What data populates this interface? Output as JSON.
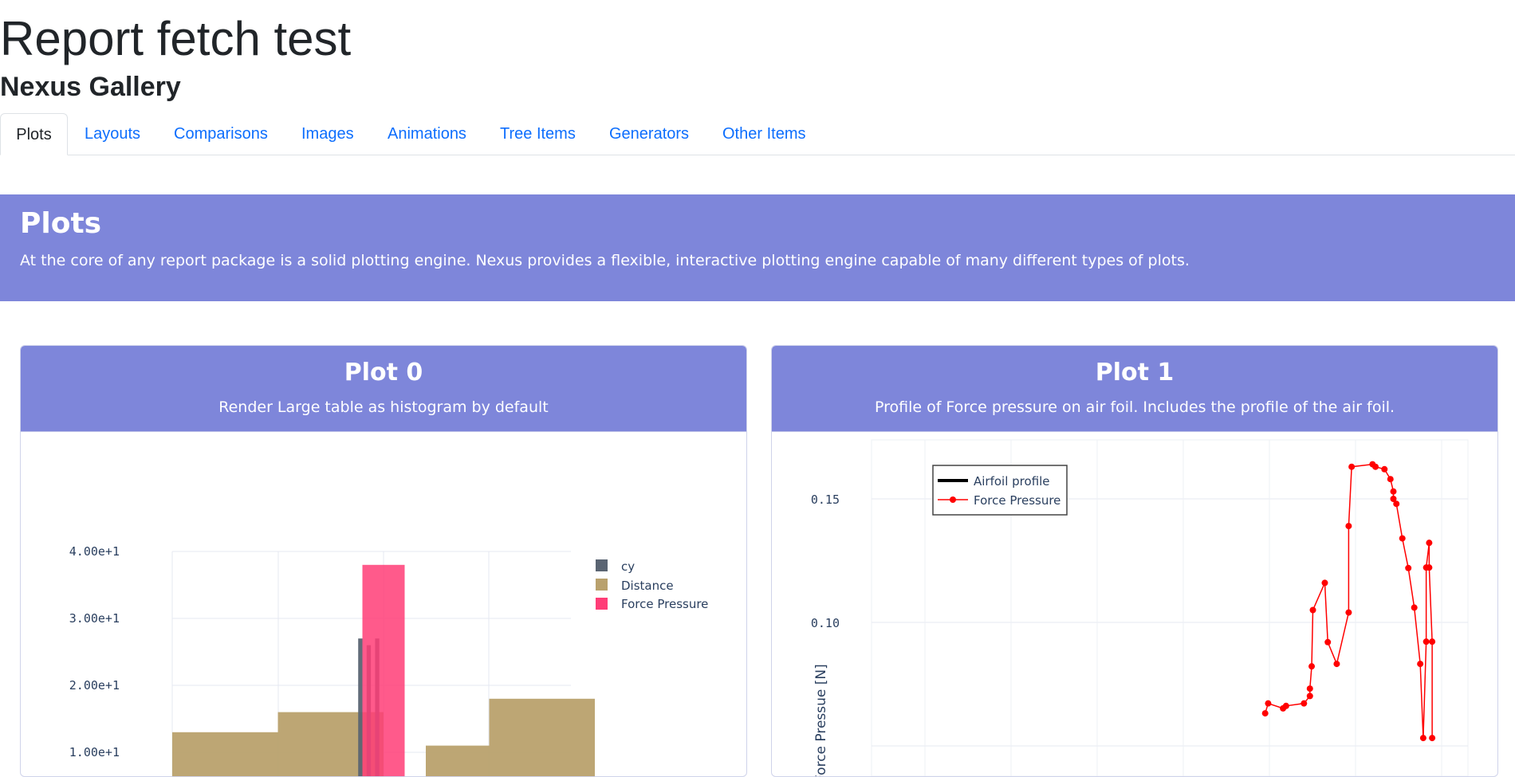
{
  "header": {
    "title": "Report fetch test",
    "gallery_title": "Nexus Gallery"
  },
  "tabs": [
    {
      "label": "Plots",
      "active": true
    },
    {
      "label": "Layouts"
    },
    {
      "label": "Comparisons"
    },
    {
      "label": "Images"
    },
    {
      "label": "Animations"
    },
    {
      "label": "Tree Items"
    },
    {
      "label": "Generators"
    },
    {
      "label": "Other Items"
    }
  ],
  "banner": {
    "title": "Plots",
    "description": "At the core of any report package is a solid plotting engine. Nexus provides a flexible, interactive plotting engine capable of many different types of plots."
  },
  "colors": {
    "banner_bg": "#7e86da",
    "link": "#0d6efd",
    "series_cy": "#5a6472",
    "series_distance": "#b9a16d",
    "series_force_pressure": "#ff3d77",
    "series_force_line": "#ff0000"
  },
  "cards": [
    {
      "title": "Plot 0",
      "subtitle": "Render Large table as histogram by default"
    },
    {
      "title": "Plot 1",
      "subtitle": "Profile of Force pressure on air foil. Includes the profile of the air foil."
    }
  ],
  "chart_data": [
    {
      "type": "bar",
      "barmode": "overlay",
      "yticks": [
        "4.00e+1",
        "3.00e+1",
        "2.00e+1",
        "1.00e+1"
      ],
      "ylim": [
        10,
        40
      ],
      "legend_placement": "top-right",
      "grid": true,
      "series": [
        {
          "name": "cy",
          "bins": [
            [
              -0.06,
              -0.05,
              27
            ],
            [
              -0.04,
              -0.03,
              26
            ],
            [
              -0.02,
              -0.01,
              27
            ]
          ]
        },
        {
          "name": "Distance",
          "bins": [
            [
              -0.5,
              -0.25,
              13
            ],
            [
              -0.25,
              0,
              16
            ],
            [
              0.1,
              0.25,
              11
            ],
            [
              0.25,
              0.5,
              18
            ]
          ]
        },
        {
          "name": "Force Pressure",
          "bins": [
            [
              -0.05,
              0.05,
              38
            ]
          ]
        }
      ]
    },
    {
      "type": "line",
      "ylabel": "Force Pressue [N]",
      "yticks": [
        "0.15",
        "0.10"
      ],
      "ylim": [
        0.05,
        0.175
      ],
      "legend_placement": "top-left",
      "grid": true,
      "series": [
        {
          "name": "Airfoil profile",
          "x": [],
          "y": []
        },
        {
          "name": "Force Pressure",
          "x": [
            0.66,
            0.665,
            0.69,
            0.695,
            0.725,
            0.735,
            0.735,
            0.738,
            0.74,
            0.76,
            0.765,
            0.78,
            0.8,
            0.8,
            0.805,
            0.84,
            0.845,
            0.86,
            0.87,
            0.875,
            0.875,
            0.88,
            0.89,
            0.9,
            0.91,
            0.92,
            0.925,
            0.93,
            0.93,
            0.935,
            0.935,
            0.94,
            0.94
          ],
          "y": [
            0.0632,
            0.0672,
            0.0652,
            0.0662,
            0.0672,
            0.0702,
            0.0732,
            0.0822,
            0.105,
            0.116,
            0.092,
            0.0832,
            0.104,
            0.139,
            0.163,
            0.164,
            0.163,
            0.162,
            0.158,
            0.153,
            0.15,
            0.148,
            0.134,
            0.122,
            0.106,
            0.0832,
            0.0532,
            0.0922,
            0.1222,
            0.1322,
            0.1222,
            0.0922,
            0.0532
          ]
        }
      ]
    }
  ]
}
